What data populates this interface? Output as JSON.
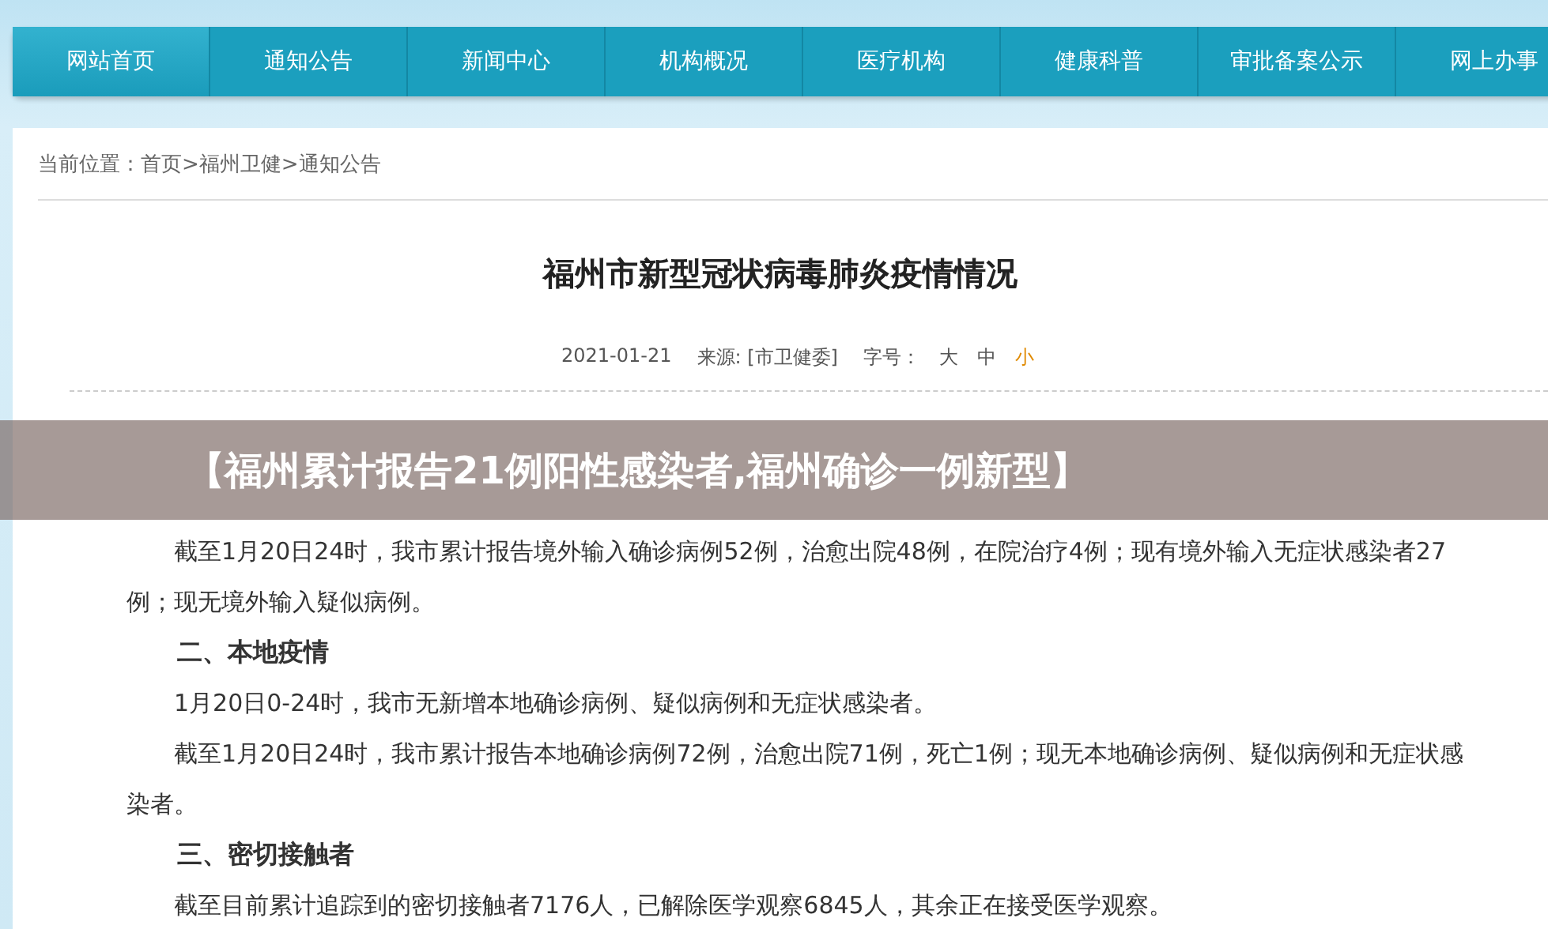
{
  "nav": [
    {
      "label": "网站首页",
      "selected": true
    },
    {
      "label": "通知公告",
      "selected": false
    },
    {
      "label": "新闻中心",
      "selected": false
    },
    {
      "label": "机构概况",
      "selected": false
    },
    {
      "label": "医疗机构",
      "selected": false
    },
    {
      "label": "健康科普",
      "selected": false
    },
    {
      "label": "审批备案公示",
      "selected": false
    },
    {
      "label": "网上办事",
      "selected": false
    }
  ],
  "breadcrumb": "当前位置：首页>福州卫健>通知公告",
  "article": {
    "title": "福州市新型冠状病毒肺炎疫情情况",
    "date": "2021-01-21",
    "source": "来源: [市卫健委]",
    "font_size_label": "字号：",
    "font_sizes": [
      {
        "label": "大",
        "selected": false
      },
      {
        "label": "中",
        "selected": false
      },
      {
        "label": "小",
        "selected": true
      }
    ],
    "body": [
      {
        "kind": "paragraph",
        "text": "截至1月20日24时，我市累计报告境外输入确诊病例52例，治愈出院48例，在院治疗4例；现有境外输入无症状感染者27例；现无境外输入疑似病例。"
      },
      {
        "kind": "heading",
        "text": "二、本地疫情"
      },
      {
        "kind": "paragraph",
        "text": "1月20日0-24时，我市无新增本地确诊病例、疑似病例和无症状感染者。"
      },
      {
        "kind": "paragraph",
        "text": "截至1月20日24时，我市累计报告本地确诊病例72例，治愈出院71例，死亡1例；现无本地确诊病例、疑似病例和无症状感染者。"
      },
      {
        "kind": "heading",
        "text": "三、密切接触者"
      },
      {
        "kind": "paragraph",
        "text": "截至目前累计追踪到的密切接触者7176人，已解除医学观察6845人，其余正在接受医学观察。"
      }
    ]
  },
  "overlay_banner": "【福州累计报告21例阳性感染者,福州确诊一例新型】"
}
